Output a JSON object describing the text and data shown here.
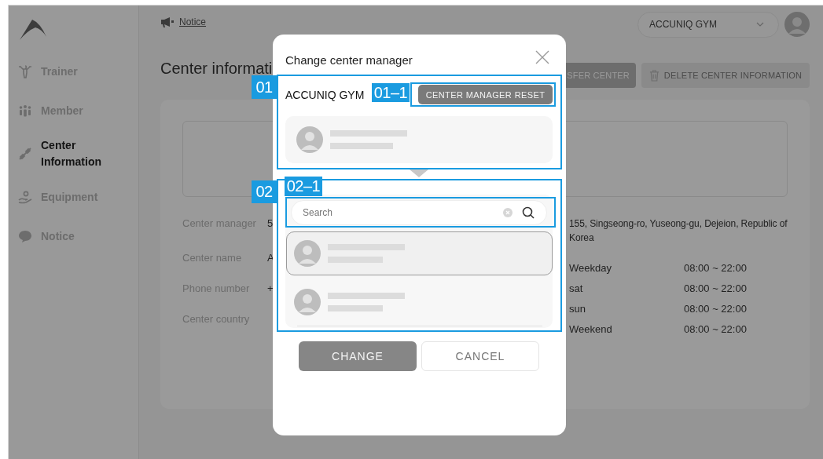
{
  "sidebar": {
    "items": [
      {
        "label": "Trainer",
        "selected": false
      },
      {
        "label": "Member",
        "selected": false
      },
      {
        "label": "Center\nInformation",
        "selected": true
      },
      {
        "label": "Equipment",
        "selected": false
      },
      {
        "label": "Notice",
        "selected": false
      }
    ]
  },
  "header": {
    "notice_link": "Notice",
    "center_select": "ACCUNIQ GYM"
  },
  "page": {
    "title": "Center informati",
    "buttons": [
      {
        "label": "SFER CENTER",
        "kind": "transfer"
      },
      {
        "label": "DELETE CENTER INFORMATION",
        "kind": "delete"
      }
    ],
    "fields": [
      {
        "label": "Center manager",
        "value": "5"
      },
      {
        "label": "Center name",
        "value": "A"
      },
      {
        "label": "Phone number",
        "value": "+"
      },
      {
        "label": "Center country"
      }
    ],
    "address": "155, Singseong-ro, Yuseong-gu, Dejeion, Republic of Korea",
    "hours": [
      {
        "day": "Weekday",
        "time": "08:00 ~ 22:00"
      },
      {
        "day": "sat",
        "time": "08:00 ~ 22:00"
      },
      {
        "day": "sun",
        "time": "08:00 ~ 22:00"
      },
      {
        "day": "Weekend",
        "time": "08:00 ~ 22:00"
      }
    ]
  },
  "dialog": {
    "title": "Change center manager",
    "center_name": "ACCUNIQ GYM",
    "reset_button": "CENTER MANAGER RESET",
    "search": {
      "placeholder": "Search"
    },
    "candidates": [
      {
        "selected": true
      },
      {
        "selected": false
      }
    ],
    "buttons": [
      {
        "label": "CHANGE",
        "kind": "primary"
      },
      {
        "label": "CANCEL",
        "kind": "secondary"
      }
    ]
  },
  "annotations": [
    {
      "label": "01"
    },
    {
      "label": "01–1"
    },
    {
      "label": "02"
    },
    {
      "label": "02–1"
    }
  ]
}
